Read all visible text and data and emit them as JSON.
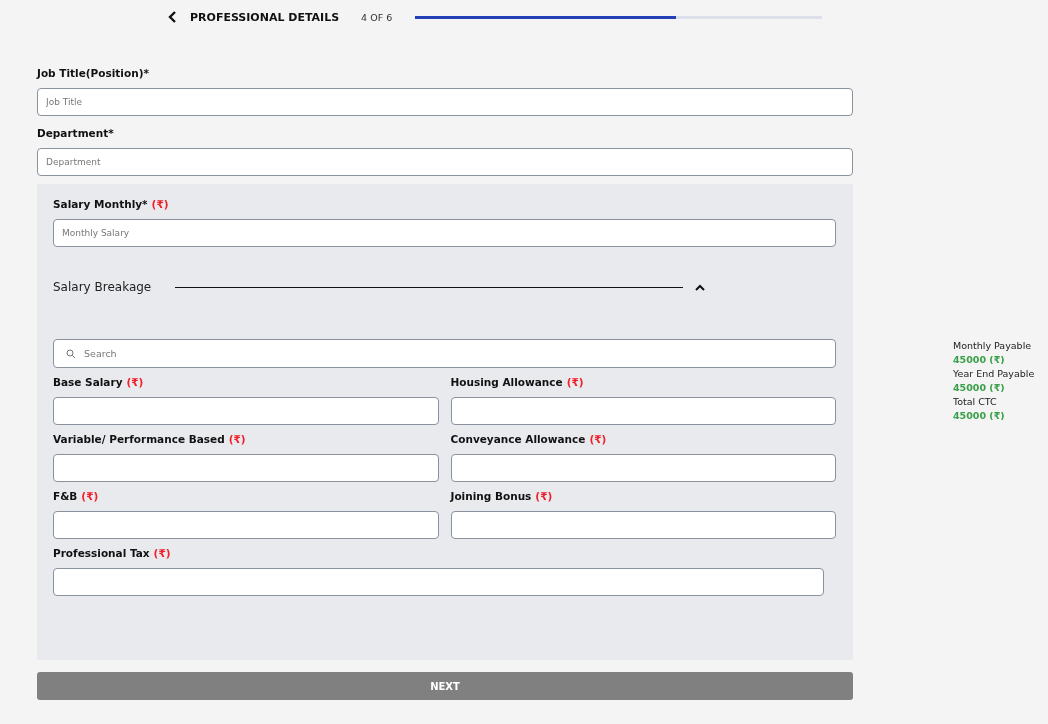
{
  "header": {
    "title": "PROFESSIONAL DETAILS",
    "step": "4 OF 6",
    "progress": {
      "level": 0.64
    }
  },
  "fields": [
    {
      "label": "Job Title(Position)*",
      "placeholder": "Job Title"
    },
    {
      "label": "Department*",
      "placeholder": "Department"
    }
  ],
  "salary_panel": {
    "monthly": {
      "label": "Salary Monthly*",
      "unit": "(₹)",
      "placeholder": "Monthly Salary"
    },
    "breakage": {
      "title": "Salary Breakage",
      "expanded": true,
      "search": {
        "placeholder": "Search"
      },
      "items": [
        {
          "label": "Base Salary",
          "unit": "(₹)"
        },
        {
          "label": "Housing Allowance",
          "unit": "(₹)"
        },
        {
          "label": "Variable/ Performance Based",
          "unit": "(₹)"
        },
        {
          "label": "Conveyance Allowance",
          "unit": "(₹)"
        },
        {
          "label": "F&B",
          "unit": "(₹)"
        },
        {
          "label": "Joining Bonus",
          "unit": "(₹)"
        },
        {
          "label": "Professional Tax",
          "unit": "(₹)"
        }
      ]
    }
  },
  "next_button": "NEXT",
  "summary": [
    {
      "label": "Monthly Payable",
      "value": "45000 (₹)"
    },
    {
      "label": "Year End Payable",
      "value": "45000 (₹)"
    },
    {
      "label": "Total CTC",
      "value": "45000 (₹)"
    }
  ]
}
